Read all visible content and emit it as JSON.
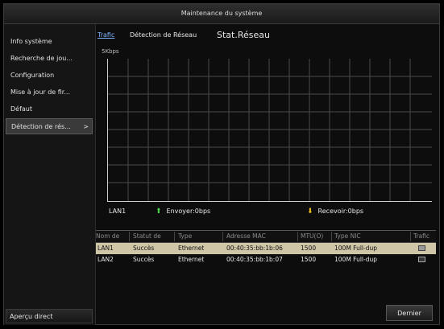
{
  "window": {
    "title": "Maintenance du système"
  },
  "sidebar": {
    "items": [
      {
        "label": "Info système"
      },
      {
        "label": "Recherche de jou..."
      },
      {
        "label": "Configuration"
      },
      {
        "label": "Mise à jour de fir..."
      },
      {
        "label": "Défaut"
      },
      {
        "label": "Détection de rés..."
      }
    ],
    "active_arrow": ">",
    "bottom_label": "Aperçu direct"
  },
  "tabs": [
    {
      "label": "Trafic"
    },
    {
      "label": "Détection de Réseau"
    },
    {
      "label": "Stat.Réseau"
    }
  ],
  "chart": {
    "unit_label": "5Kbps",
    "legend": {
      "interface": "LAN1",
      "send_label": "Envoyer:0bps",
      "receive_label": "Recevoir:0bps"
    },
    "colors": {
      "send": "#4fd64f",
      "receive": "#f2c21c"
    }
  },
  "table": {
    "headers": [
      "Nom de",
      "Statut de",
      "Type",
      "Adresse MAC",
      "MTU(O)",
      "Type NIC",
      "Trafic"
    ],
    "rows": [
      [
        "LAN1",
        "Succès",
        "Ethernet",
        "00:40:35:bb:1b:06",
        "1500",
        "100M Full-dup"
      ],
      [
        "LAN2",
        "Succès",
        "Ethernet",
        "00:40:35:bb:1b:07",
        "1500",
        "100M Full-dup"
      ]
    ]
  },
  "footer": {
    "back_label": "Dernier"
  }
}
